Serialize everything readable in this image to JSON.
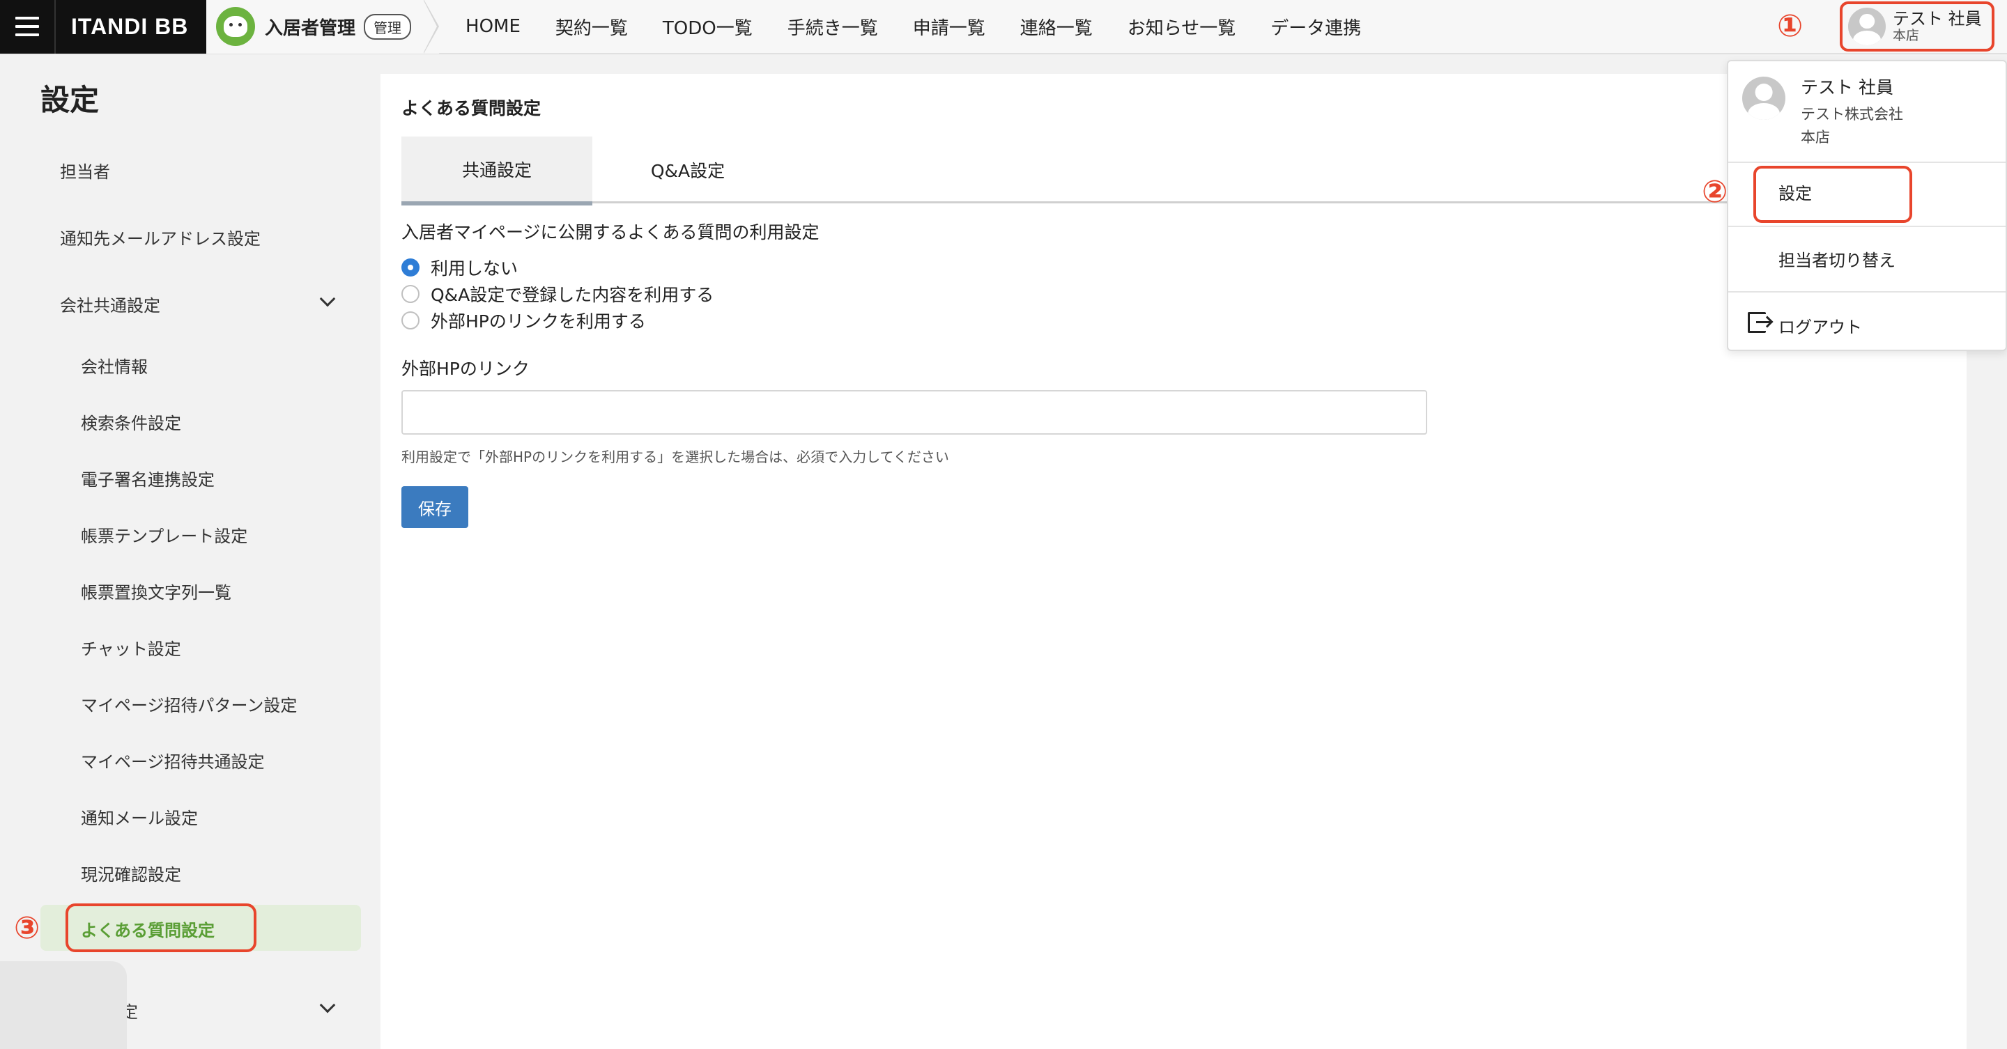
{
  "header": {
    "logo": "ITANDI BB",
    "app_name": "入居者管理",
    "app_badge": "管理",
    "nav": [
      "HOME",
      "契約一覧",
      "TODO一覧",
      "手続き一覧",
      "申請一覧",
      "連絡一覧",
      "お知らせ一覧",
      "データ連携"
    ],
    "user_name": "テスト 社員",
    "user_branch": "本店"
  },
  "annotations": {
    "one": "①",
    "two": "②",
    "three": "③"
  },
  "sidebar": {
    "title": "設定",
    "items": {
      "tantousha": "担当者",
      "notify_email": "通知先メールアドレス設定",
      "company_common": "会社共通設定",
      "company_info": "会社情報",
      "search_condition": "検索条件設定",
      "esign": "電子署名連携設定",
      "form_template": "帳票テンプレート設定",
      "form_replace": "帳票置換文字列一覧",
      "chat": "チャット設定",
      "mypage_invite_pattern": "マイページ招待パターン設定",
      "mypage_invite_common": "マイページ招待共通設定",
      "notify_mail": "通知メール設定",
      "status_check": "現況確認設定",
      "faq": "よくある質問設定",
      "partial": "設定"
    }
  },
  "main": {
    "title": "よくある質問設定",
    "tabs": [
      "共通設定",
      "Q&A設定"
    ],
    "usage_label": "入居者マイページに公開するよくある質問の利用設定",
    "options": [
      "利用しない",
      "Q&A設定で登録した内容を利用する",
      "外部HPのリンクを利用する"
    ],
    "selected_option": 0,
    "link_label": "外部HPのリンク",
    "link_value": "",
    "help_text": "利用設定で「外部HPのリンクを利用する」を選択した場合は、必須で入力してください",
    "save_label": "保存"
  },
  "dropdown": {
    "name": "テスト 社員",
    "company": "テスト株式会社",
    "branch": "本店",
    "settings": "設定",
    "switch_user": "担当者切り替え",
    "logout": "ログアウト"
  },
  "colors": {
    "accent_green": "#6cb33f",
    "annotation_red": "#e8452c",
    "primary_blue": "#3b7bbf"
  }
}
